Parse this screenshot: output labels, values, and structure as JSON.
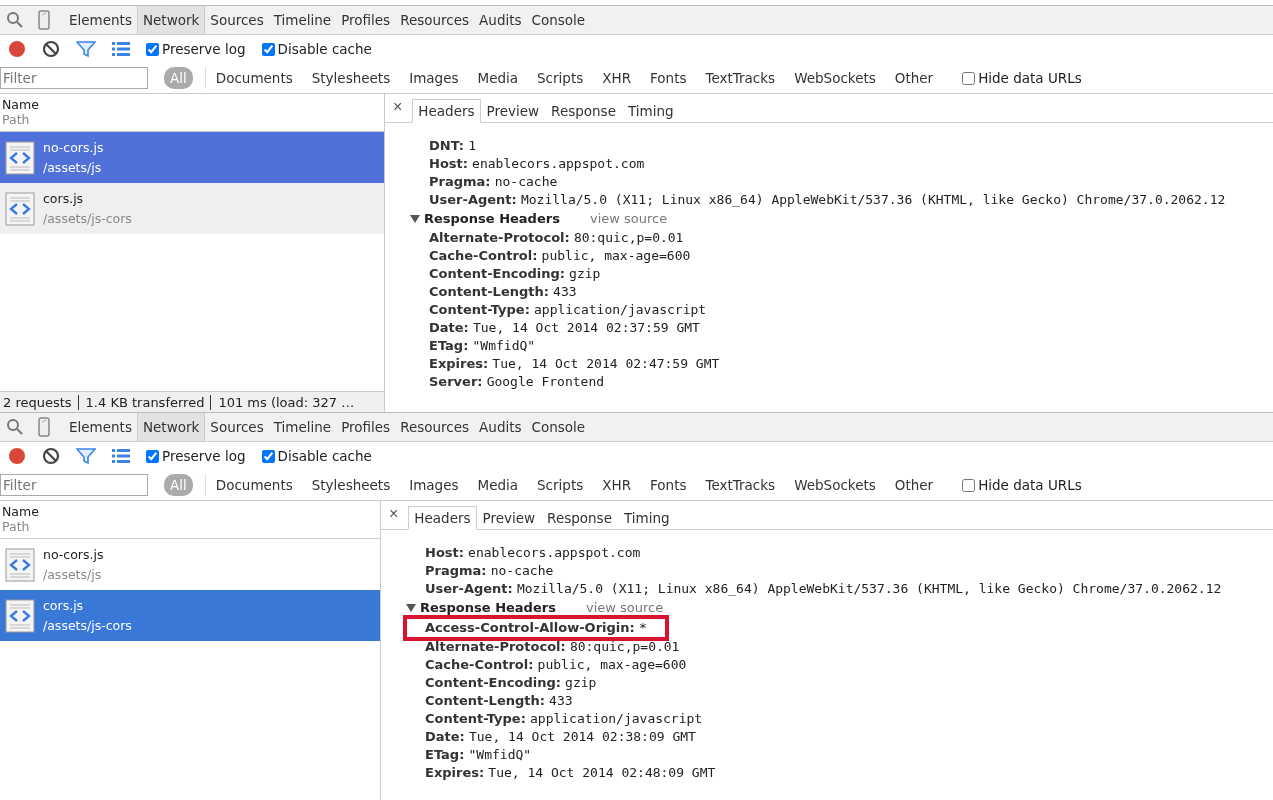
{
  "panels": [
    {
      "tabs": [
        {
          "label": "Elements",
          "selected": false
        },
        {
          "label": "Network",
          "selected": true
        },
        {
          "label": "Sources",
          "selected": false
        },
        {
          "label": "Timeline",
          "selected": false
        },
        {
          "label": "Profiles",
          "selected": false
        },
        {
          "label": "Resources",
          "selected": false
        },
        {
          "label": "Audits",
          "selected": false
        },
        {
          "label": "Console",
          "selected": false
        }
      ],
      "options": [
        {
          "label": "Preserve log",
          "checked": true
        },
        {
          "label": "Disable cache",
          "checked": true
        }
      ],
      "filter": {
        "placeholder": "Filter"
      },
      "types": [
        {
          "label": "All",
          "selected": true
        },
        {
          "label": "Documents",
          "selected": false
        },
        {
          "label": "Stylesheets",
          "selected": false
        },
        {
          "label": "Images",
          "selected": false
        },
        {
          "label": "Media",
          "selected": false
        },
        {
          "label": "Scripts",
          "selected": false
        },
        {
          "label": "XHR",
          "selected": false
        },
        {
          "label": "Fonts",
          "selected": false
        },
        {
          "label": "TextTracks",
          "selected": false
        },
        {
          "label": "WebSockets",
          "selected": false
        },
        {
          "label": "Other",
          "selected": false
        }
      ],
      "hide_data_urls": {
        "label": "Hide data URLs",
        "checked": false
      },
      "columns": {
        "name": "Name",
        "path": "Path"
      },
      "requests": [
        {
          "name": "no-cors.js",
          "path": "/assets/js",
          "selected": true
        },
        {
          "name": "cors.js",
          "path": "/assets/js-cors",
          "selected": false
        }
      ],
      "status_bar": [
        "2 requests",
        "1.4 KB transferred",
        "101 ms (load: 327 …"
      ],
      "details": {
        "close": "×",
        "tabs": [
          {
            "label": "Headers",
            "selected": true
          },
          {
            "label": "Preview",
            "selected": false
          },
          {
            "label": "Response",
            "selected": false
          },
          {
            "label": "Timing",
            "selected": false
          }
        ],
        "request_headers": [
          {
            "name": "DNT:",
            "value": "1"
          },
          {
            "name": "Host:",
            "value": "enablecors.appspot.com"
          },
          {
            "name": "Pragma:",
            "value": "no-cache"
          },
          {
            "name": "User-Agent:",
            "value": "Mozilla/5.0 (X11; Linux x86_64) AppleWebKit/537.36 (KHTML, like Gecko) Chrome/37.0.2062.12"
          }
        ],
        "response_section": {
          "title": "Response Headers",
          "expanded": true,
          "link": "view source"
        },
        "response_headers": [
          {
            "name": "Alternate-Protocol:",
            "value": "80:quic,p=0.01",
            "highlighted": false
          },
          {
            "name": "Cache-Control:",
            "value": "public, max-age=600",
            "highlighted": false
          },
          {
            "name": "Content-Encoding:",
            "value": "gzip",
            "highlighted": false
          },
          {
            "name": "Content-Length:",
            "value": "433",
            "highlighted": false
          },
          {
            "name": "Content-Type:",
            "value": "application/javascript",
            "highlighted": false
          },
          {
            "name": "Date:",
            "value": "Tue, 14 Oct 2014 02:37:59 GMT",
            "highlighted": false
          },
          {
            "name": "ETag:",
            "value": "\"WmfidQ\"",
            "highlighted": false
          },
          {
            "name": "Expires:",
            "value": "Tue, 14 Oct 2014 02:47:59 GMT",
            "highlighted": false
          },
          {
            "name": "Server:",
            "value": "Google Frontend",
            "highlighted": false
          }
        ]
      }
    },
    {
      "tabs": [
        {
          "label": "Elements",
          "selected": false
        },
        {
          "label": "Network",
          "selected": true
        },
        {
          "label": "Sources",
          "selected": false
        },
        {
          "label": "Timeline",
          "selected": false
        },
        {
          "label": "Profiles",
          "selected": false
        },
        {
          "label": "Resources",
          "selected": false
        },
        {
          "label": "Audits",
          "selected": false
        },
        {
          "label": "Console",
          "selected": false
        }
      ],
      "options": [
        {
          "label": "Preserve log",
          "checked": true
        },
        {
          "label": "Disable cache",
          "checked": true
        }
      ],
      "filter": {
        "placeholder": "Filter"
      },
      "types": [
        {
          "label": "All",
          "selected": true
        },
        {
          "label": "Documents",
          "selected": false
        },
        {
          "label": "Stylesheets",
          "selected": false
        },
        {
          "label": "Images",
          "selected": false
        },
        {
          "label": "Media",
          "selected": false
        },
        {
          "label": "Scripts",
          "selected": false
        },
        {
          "label": "XHR",
          "selected": false
        },
        {
          "label": "Fonts",
          "selected": false
        },
        {
          "label": "TextTracks",
          "selected": false
        },
        {
          "label": "WebSockets",
          "selected": false
        },
        {
          "label": "Other",
          "selected": false
        }
      ],
      "hide_data_urls": {
        "label": "Hide data URLs",
        "checked": false
      },
      "columns": {
        "name": "Name",
        "path": "Path"
      },
      "requests": [
        {
          "name": "no-cors.js",
          "path": "/assets/js",
          "selected": false
        },
        {
          "name": "cors.js",
          "path": "/assets/js-cors",
          "selected": true
        }
      ],
      "details": {
        "close": "×",
        "tabs": [
          {
            "label": "Headers",
            "selected": true
          },
          {
            "label": "Preview",
            "selected": false
          },
          {
            "label": "Response",
            "selected": false
          },
          {
            "label": "Timing",
            "selected": false
          }
        ],
        "request_headers": [
          {
            "name": "Host:",
            "value": "enablecors.appspot.com"
          },
          {
            "name": "Pragma:",
            "value": "no-cache"
          },
          {
            "name": "User-Agent:",
            "value": "Mozilla/5.0 (X11; Linux x86_64) AppleWebKit/537.36 (KHTML, like Gecko) Chrome/37.0.2062.12"
          }
        ],
        "response_section": {
          "title": "Response Headers",
          "expanded": true,
          "link": "view source"
        },
        "response_headers": [
          {
            "name": "Access-Control-Allow-Origin:",
            "value": "*",
            "highlighted": true
          },
          {
            "name": "Alternate-Protocol:",
            "value": "80:quic,p=0.01",
            "highlighted": false
          },
          {
            "name": "Cache-Control:",
            "value": "public, max-age=600",
            "highlighted": false
          },
          {
            "name": "Content-Encoding:",
            "value": "gzip",
            "highlighted": false
          },
          {
            "name": "Content-Length:",
            "value": "433",
            "highlighted": false
          },
          {
            "name": "Content-Type:",
            "value": "application/javascript",
            "highlighted": false
          },
          {
            "name": "Date:",
            "value": "Tue, 14 Oct 2014 02:38:09 GMT",
            "highlighted": false
          },
          {
            "name": "ETag:",
            "value": "\"WmfidQ\"",
            "highlighted": false
          },
          {
            "name": "Expires:",
            "value": "Tue, 14 Oct 2014 02:48:09 GMT",
            "highlighted": false
          }
        ]
      }
    }
  ]
}
